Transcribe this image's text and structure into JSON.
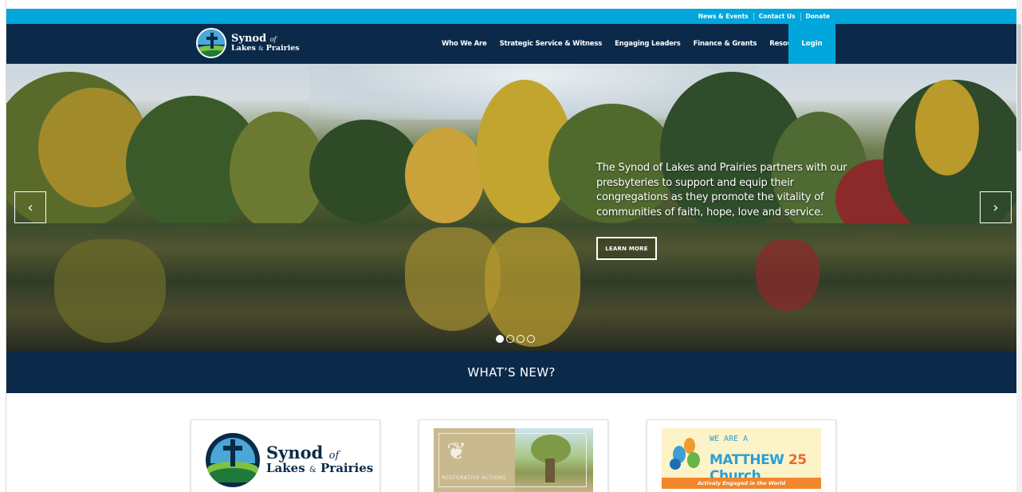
{
  "utility": {
    "links": [
      "News & Events",
      "Contact Us",
      "Donate"
    ]
  },
  "logo": {
    "line1": "Synod",
    "of": "of",
    "line2a": "Lakes",
    "amp": "&",
    "line2b": "Prairies"
  },
  "nav": {
    "items": [
      "Who We Are",
      "Strategic Service & Witness",
      "Engaging Leaders",
      "Finance & Grants",
      "Resources"
    ],
    "login": "Login"
  },
  "hero": {
    "text": "The Synod of Lakes and Prairies partners with our presbyteries to support and equip their congregations as they promote the vitality of communities of faith, hope, love and service.",
    "button": "LEARN MORE",
    "prev_icon": "‹",
    "next_icon": "›",
    "slides": 4,
    "active_slide": 1
  },
  "section": {
    "title": "WHAT’S NEW?"
  },
  "cards": {
    "card1": {
      "line1": "Synod",
      "of": "of",
      "line2a": "Lakes",
      "amp": "&",
      "line2b": "Prairies"
    },
    "card2": {
      "caption": "RESTORATIVE ACTIONS"
    },
    "card3": {
      "we_are": "WE ARE A",
      "matthew": "MATTHEW",
      "num": "25",
      "church": "Church",
      "tagline": "Actively Engaged in the World"
    }
  },
  "colors": {
    "navy": "#0b2a4a",
    "cyan": "#00a6dc",
    "orange": "#f2862a"
  }
}
